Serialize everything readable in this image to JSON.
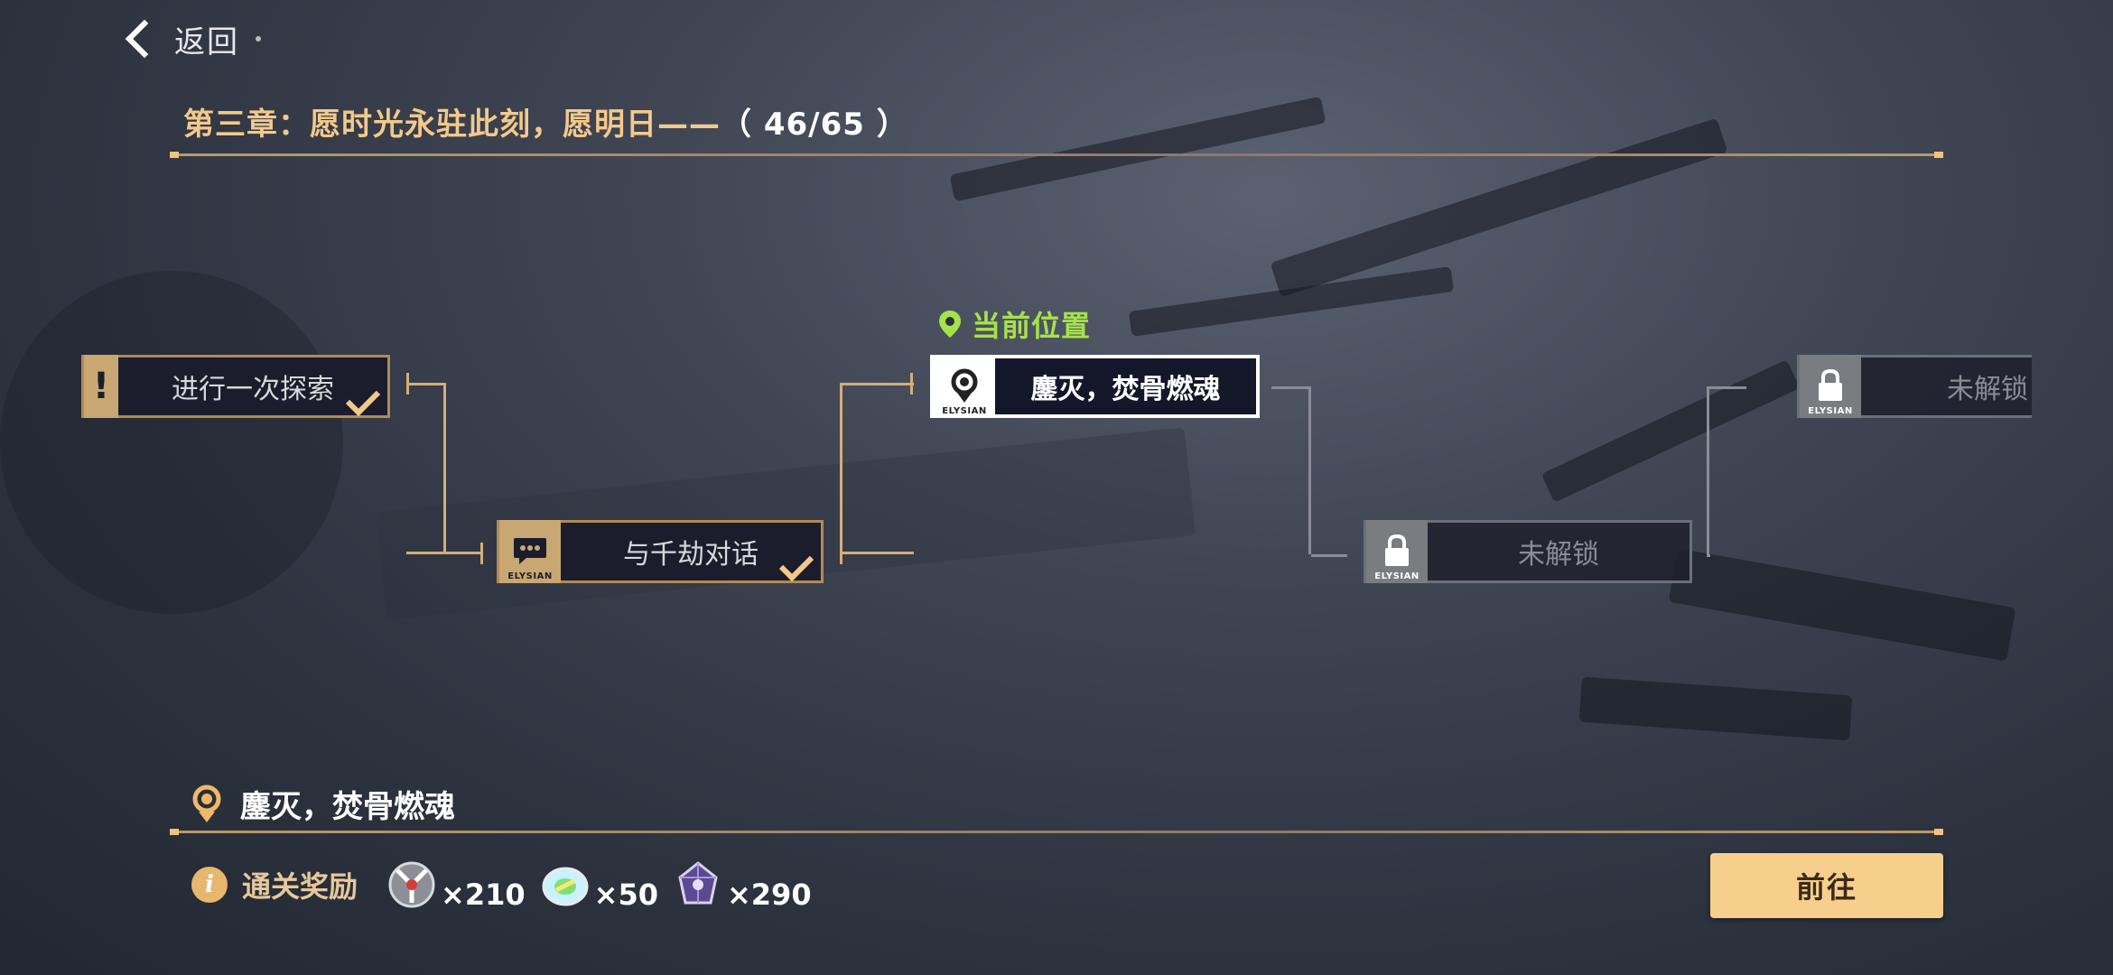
{
  "header": {
    "back_label": "返回"
  },
  "chapter": {
    "title": "第三章：愿时光永驻此刻，愿明日——",
    "progress": "（ 46/65 ）"
  },
  "current_marker": {
    "label": "当前位置"
  },
  "nodes": [
    {
      "label": "进行一次探索",
      "state": "done",
      "icon": "exclamation-icon"
    },
    {
      "label": "与千劫对话",
      "state": "done",
      "icon": "chat-bubble-icon",
      "badge": "ELYSIAN"
    },
    {
      "label": "鏖灭，焚骨燃魂",
      "state": "current",
      "icon": "location-pin-icon",
      "badge": "ELYSIAN"
    },
    {
      "label": "未解锁",
      "state": "locked",
      "icon": "lock-icon",
      "badge": "ELYSIAN"
    },
    {
      "label": "未解锁",
      "state": "locked",
      "icon": "lock-icon",
      "badge": "ELYSIAN"
    }
  ],
  "stage": {
    "name": "鏖灭，焚骨燃魂"
  },
  "rewards": {
    "label": "通关奖励",
    "info_glyph": "i",
    "items": [
      {
        "icon": "valkyrie-emblem-icon",
        "amount": "×210"
      },
      {
        "icon": "crystal-disc-icon",
        "amount": "×50"
      },
      {
        "icon": "purple-gem-icon",
        "amount": "×290"
      }
    ]
  },
  "actions": {
    "go_label": "前往"
  },
  "colors": {
    "accent_gold": "#f3c98b",
    "current_green": "#a6e24a",
    "button": "#f7cf8c"
  }
}
